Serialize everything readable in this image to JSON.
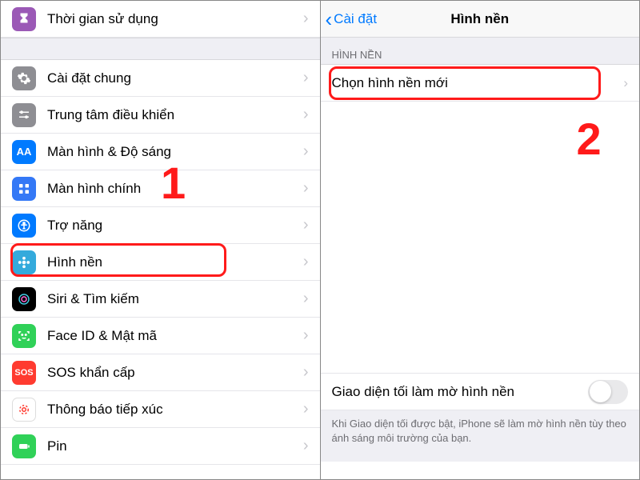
{
  "left": {
    "items": [
      {
        "label": "Thời gian sử dụng"
      },
      {
        "label": "Cài đặt chung"
      },
      {
        "label": "Trung tâm điều khiển"
      },
      {
        "label": "Màn hình & Độ sáng"
      },
      {
        "label": "Màn hình chính"
      },
      {
        "label": "Trợ năng"
      },
      {
        "label": "Hình nền"
      },
      {
        "label": "Siri & Tìm kiếm"
      },
      {
        "label": "Face ID & Mật mã"
      },
      {
        "label": "SOS khẩn cấp"
      },
      {
        "label": "Thông báo tiếp xúc"
      },
      {
        "label": "Pin"
      }
    ]
  },
  "right": {
    "back": "Cài đặt",
    "title": "Hình nền",
    "section": "HÌNH NỀN",
    "choose": "Chọn hình nền mới",
    "dark_label": "Giao diện tối làm mờ hình nền",
    "footer": "Khi Giao diện tối được bật, iPhone sẽ làm mờ hình nền tùy theo ánh sáng môi trường của bạn."
  },
  "annotations": {
    "one": "1",
    "two": "2"
  },
  "colors": {
    "accent": "#007aff",
    "highlight": "#ff1a1a"
  }
}
